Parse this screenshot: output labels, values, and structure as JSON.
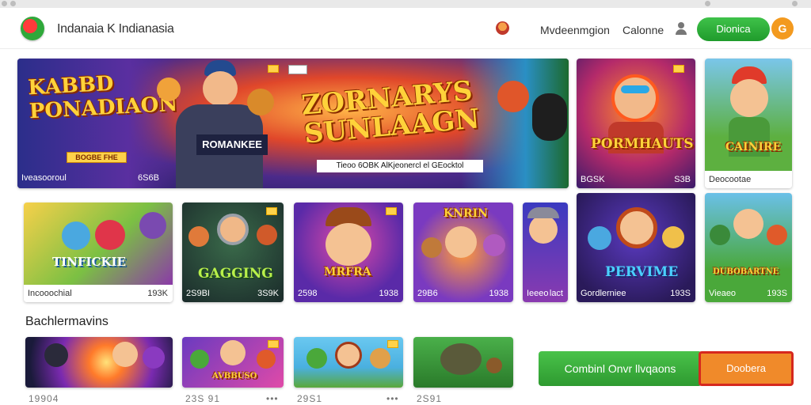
{
  "header": {
    "site_title": "Indanaia K Indianasia",
    "nav": [
      "Mvdeenmgion",
      "Calonne"
    ],
    "green_button": "Dionica",
    "orange_button": "G"
  },
  "hero": {
    "title_left": "KABBD PONADIAON",
    "title_right_1": "ZORNARYS",
    "title_right_2": "SUNLAAGN",
    "character_label": "ROMANKEE",
    "left_badge": "BOGBE FHE",
    "banner_text": "Tieoo 6OBK AlKjeonercl el GEocktol",
    "caption_left": "Iveasooroul",
    "caption_mid": "6S6B"
  },
  "side_cards": [
    {
      "title": "PORMHAUTS",
      "caption_left": "BGSK",
      "caption_right": "S3B"
    },
    {
      "title": "CAINIRE",
      "caption_left": "Deocootae",
      "caption_right": ""
    }
  ],
  "row2": [
    {
      "title": "TINFICKIE",
      "caption_left": "Incooochial",
      "caption_right": "193K"
    },
    {
      "title": "GAGGING",
      "caption_left": "2S9BI",
      "caption_right": "3S9K"
    },
    {
      "title": "MRFRA",
      "caption_left": "2598",
      "caption_right": "1938"
    },
    {
      "title": "KNRIN",
      "caption_left": "29B6",
      "caption_right": "1938"
    },
    {
      "title": "",
      "caption_left": "Ieeeo",
      "caption_right": "lact"
    },
    {
      "title": "PERVIME",
      "caption_left": "Gordlerniee",
      "caption_right": "193S"
    },
    {
      "title": "DUBOBARTNE",
      "caption_left": "Vieaeo",
      "caption_right": "193S"
    }
  ],
  "section": {
    "title": "Bachlermavins"
  },
  "row3": [
    {
      "caption": "19904"
    },
    {
      "caption": "23S 91",
      "title": "AVBBUSO"
    },
    {
      "caption": "29S1"
    },
    {
      "caption": "2S91"
    }
  ],
  "ctas": {
    "green": "Combinl Onvr llvqaons",
    "orange": "Doobera"
  },
  "dots": "•••"
}
